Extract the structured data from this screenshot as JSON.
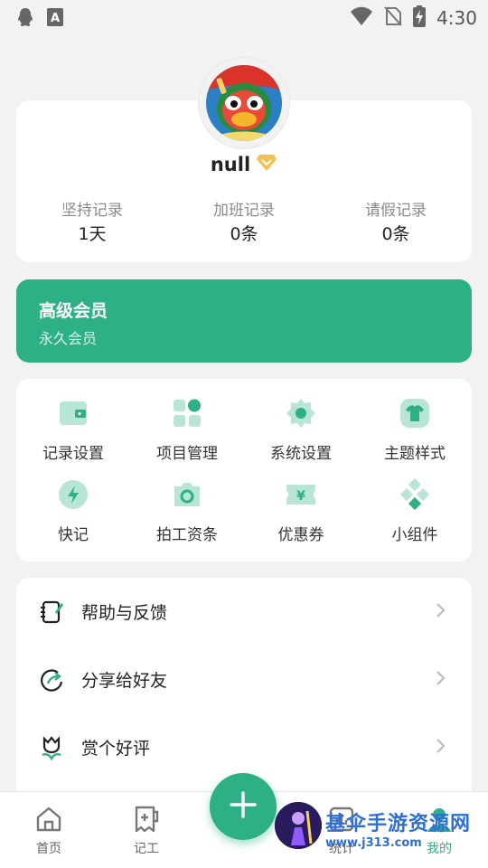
{
  "status_bar": {
    "time": "4:30",
    "left_icons": [
      "qq-icon",
      "font-a-icon"
    ],
    "right_icons": [
      "wifi-icon",
      "no-sim-icon",
      "battery-charging-icon"
    ]
  },
  "profile": {
    "username": "null",
    "badge_icon": "vip-diamond-icon",
    "stats": [
      {
        "label": "坚持记录",
        "value": "1天"
      },
      {
        "label": "加班记录",
        "value": "0条"
      },
      {
        "label": "请假记录",
        "value": "0条"
      }
    ]
  },
  "vip": {
    "title": "高级会员",
    "subtitle": "永久会员"
  },
  "features": [
    {
      "label": "记录设置",
      "icon": "wallet-icon"
    },
    {
      "label": "项目管理",
      "icon": "apps-grid-icon"
    },
    {
      "label": "系统设置",
      "icon": "gear-icon"
    },
    {
      "label": "主题样式",
      "icon": "shirt-icon"
    },
    {
      "label": "快记",
      "icon": "lightning-icon"
    },
    {
      "label": "拍工资条",
      "icon": "camera-icon"
    },
    {
      "label": "优惠券",
      "icon": "coupon-icon"
    },
    {
      "label": "小组件",
      "icon": "widget-icon"
    }
  ],
  "menu": [
    {
      "label": "帮助与反馈",
      "icon": "notebook-pen-icon"
    },
    {
      "label": "分享给好友",
      "icon": "share-refresh-icon"
    },
    {
      "label": "赏个好评",
      "icon": "tulip-icon"
    }
  ],
  "tabs": [
    {
      "label": "首页",
      "icon": "home-icon"
    },
    {
      "label": "记工",
      "icon": "record-icon"
    },
    {
      "label": "统计",
      "icon": "stats-icon"
    },
    {
      "label": "我的",
      "icon": "profile-icon"
    }
  ],
  "fab": {
    "icon": "plus-icon"
  },
  "watermark": {
    "title": "基伞手游资源网",
    "url": "www.j313.com"
  },
  "colors": {
    "accent": "#2db085",
    "icon_light": "#b9e6d4",
    "badge": "#f2c14e",
    "background": "#f2f2f2"
  }
}
